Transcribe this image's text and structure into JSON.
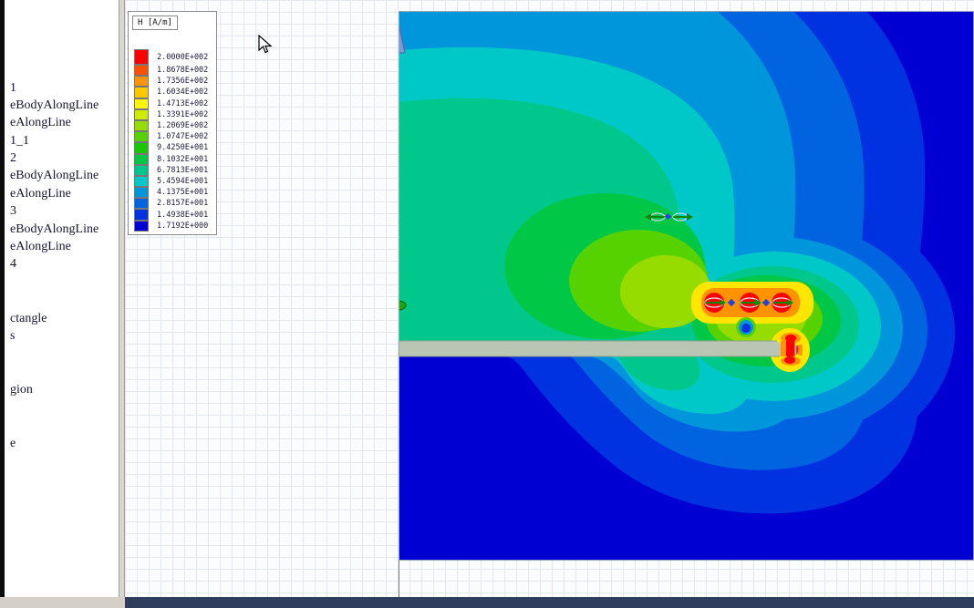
{
  "sidebar": {
    "items": [
      "1",
      "eBodyAlongLine",
      "eAlongLine",
      "1_1",
      "2",
      "eBodyAlongLine",
      "eAlongLine",
      "3",
      "eBodyAlongLine",
      "eAlongLine",
      "4",
      "ctangle",
      "s",
      "gion",
      "e"
    ]
  },
  "legend": {
    "title": "H [A/m]",
    "entries": [
      {
        "color": "#ff0000",
        "value": "2.0000E+002"
      },
      {
        "color": "#ff4f00",
        "value": "1.8678E+002"
      },
      {
        "color": "#ff9400",
        "value": "1.7356E+002"
      },
      {
        "color": "#ffc800",
        "value": "1.6034E+002"
      },
      {
        "color": "#fff500",
        "value": "1.4713E+002"
      },
      {
        "color": "#cdeb00",
        "value": "1.3391E+002"
      },
      {
        "color": "#96dc00",
        "value": "1.2069E+002"
      },
      {
        "color": "#55d200",
        "value": "1.0747E+002"
      },
      {
        "color": "#19c805",
        "value": "9.4250E+001"
      },
      {
        "color": "#00c846",
        "value": "8.1032E+001"
      },
      {
        "color": "#00c88c",
        "value": "6.7813E+001"
      },
      {
        "color": "#00c8c8",
        "value": "5.4594E+001"
      },
      {
        "color": "#0096dc",
        "value": "4.1375E+001"
      },
      {
        "color": "#0064e1",
        "value": "2.8157E+001"
      },
      {
        "color": "#0032e1",
        "value": "1.4938E+001"
      },
      {
        "color": "#0000d2",
        "value": "1.7192E+000"
      }
    ]
  },
  "plot": {
    "background_color": "#0000d2",
    "plate_color": "#b9c6b4"
  },
  "icons": {
    "cursor": "mouse-arrow"
  }
}
